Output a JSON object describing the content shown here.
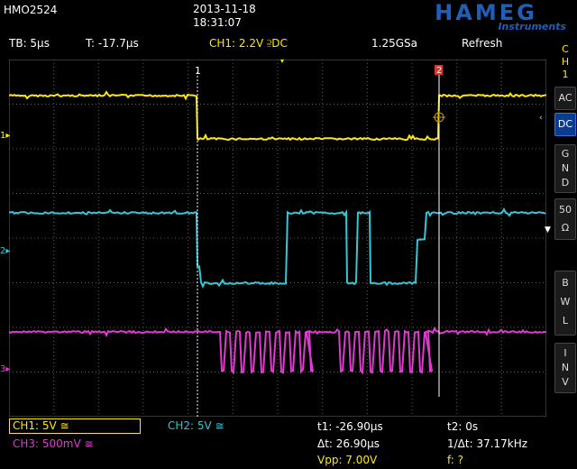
{
  "header": {
    "model": "HMO2524",
    "date": "2013-11-18",
    "time": "18:31:07",
    "logo_name": "HAMEG",
    "logo_sub": "Instruments"
  },
  "infobar": {
    "timebase": "TB: 5µs",
    "trigger_time": "T: -17.7µs",
    "trigger_source": "CH1: 2.2V ⫆DC",
    "sample_rate": "1.25GSa",
    "acq_mode": "Refresh"
  },
  "sidebar": {
    "channel": "C\nH\n1",
    "ac": "AC",
    "dc": "DC",
    "gnd": "G\nN\nD",
    "imp": "50\nΩ",
    "bwl": "B\nW\nL",
    "inv": "I\nN\nV"
  },
  "bottombar": {
    "ch1": "CH1: 5V ≅",
    "ch2": "CH2: 5V ≅",
    "ch3": "CH3: 500mV ≅",
    "t1": "t1: -26.90µs",
    "t2": "t2: 0s",
    "dt": "Δt: 26.90µs",
    "inv_dt": "1/Δt: 37.17kHz",
    "vpp": "Vpp: 7.00V",
    "freq": "f: ?"
  },
  "markers": {
    "cursor1": "1",
    "cursor2": "2",
    "ch1_ref": "1",
    "ch2_ref": "2",
    "ch3_ref": "3"
  },
  "colors": {
    "ch1": "#ffea00",
    "ch2": "#31c8d8",
    "ch3": "#e03ad2",
    "grid": "#5a5a5a",
    "brand": "#1f5fb8"
  }
}
